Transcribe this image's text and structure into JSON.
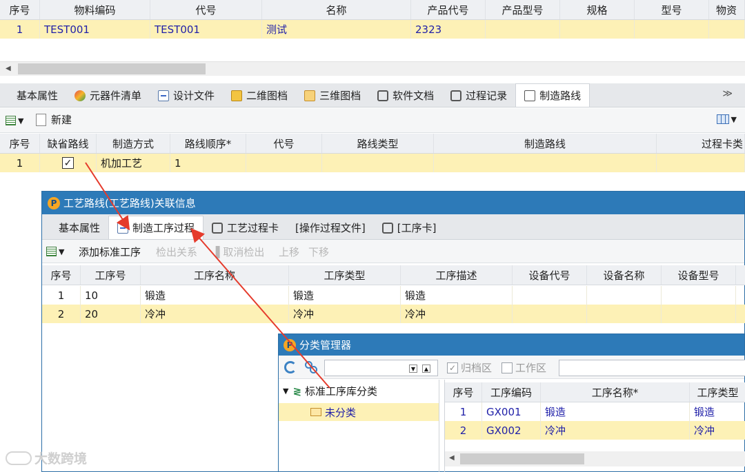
{
  "top_grid": {
    "columns": [
      "序号",
      "物料编码",
      "代号",
      "名称",
      "产品代号",
      "产品型号",
      "规格",
      "型号",
      "物资"
    ],
    "row": [
      "1",
      "TEST001",
      "TEST001",
      "测试",
      "2323",
      "",
      "",
      "",
      ""
    ]
  },
  "tabs1": [
    {
      "label": "基本属性",
      "icon": "none"
    },
    {
      "label": "元器件清单",
      "icon": "component-icon"
    },
    {
      "label": "设计文件",
      "icon": "design-file-icon"
    },
    {
      "label": "二维图档",
      "icon": "drawing-2d-icon"
    },
    {
      "label": "三维图档",
      "icon": "model-3d-icon"
    },
    {
      "label": "软件文档",
      "icon": "software-doc-icon"
    },
    {
      "label": "过程记录",
      "icon": "process-record-icon"
    },
    {
      "label": "制造路线",
      "icon": "route-icon"
    }
  ],
  "toolbar1": {
    "new_label": "新建",
    "more_symbol": "≫"
  },
  "grid2": {
    "columns": [
      "序号",
      "缺省路线",
      "制造方式",
      "路线顺序*",
      "代号",
      "路线类型",
      "制造路线",
      "过程卡类"
    ],
    "row": {
      "no": "1",
      "default_route": "✓",
      "method": "机加工艺",
      "order": "1"
    }
  },
  "window1": {
    "title": "工艺路线(工艺路线)关联信息",
    "tabs": [
      "基本属性",
      "制造工序过程",
      "工艺过程卡",
      "[操作过程文件]",
      "[工序卡]"
    ],
    "toolbar": [
      "添加标准工序",
      "检出关系",
      "取消检出",
      "上移",
      "下移"
    ],
    "columns": [
      "序号",
      "工序号",
      "工序名称",
      "工序类型",
      "工序描述",
      "设备代号",
      "设备名称",
      "设备型号"
    ],
    "rows": [
      {
        "no": "1",
        "op_no": "10",
        "name": "锻造",
        "type": "锻造",
        "desc": "锻造"
      },
      {
        "no": "2",
        "op_no": "20",
        "name": "冷冲",
        "type": "冷冲",
        "desc": "冷冲"
      }
    ]
  },
  "window2": {
    "title": "分类管理器",
    "archive_label": "归档区",
    "work_label": "工作区",
    "tree_root": "标准工序库分类",
    "tree_child": "未分类",
    "columns": [
      "序号",
      "工序编码",
      "工序名称*",
      "工序类型"
    ],
    "rows": [
      {
        "no": "1",
        "code": "GX001",
        "name": "锻造",
        "type": "锻造"
      },
      {
        "no": "2",
        "code": "GX002",
        "name": "冷冲",
        "type": "冷冲"
      }
    ]
  },
  "watermark": "大数跨境",
  "colors": {
    "title_bar": "#2d7ab8",
    "selected_row": "#fdf1b6",
    "annotation": "#e53b2c",
    "link_text": "#1f1fa8"
  }
}
